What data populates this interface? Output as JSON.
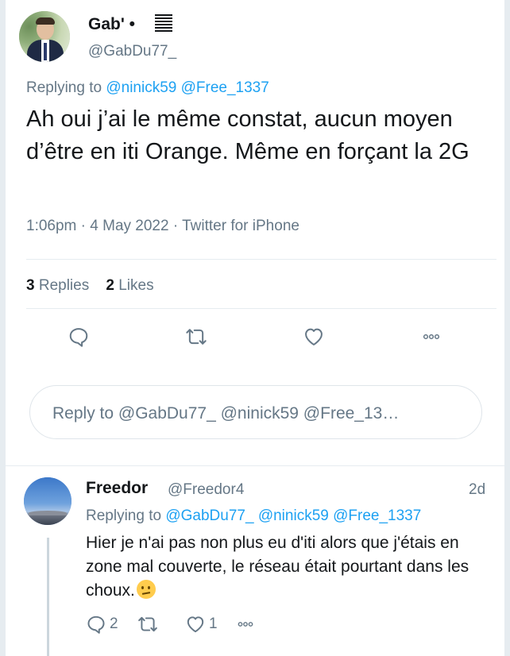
{
  "main_tweet": {
    "name": "Gab' •",
    "handle": "@GabDu77_",
    "replying_prefix": "Replying to",
    "replying_mentions": [
      "@ninick59",
      "@Free_1337"
    ],
    "text": "Ah oui j’ai le même constat, aucun moyen d’être en iti Orange. Même en forçant la 2G",
    "time": "1:06pm",
    "date": "4 May 2022",
    "source": "Twitter for iPhone",
    "replies_count": "3",
    "replies_label": "Replies",
    "likes_count": "2",
    "likes_label": "Likes",
    "icons": [
      "reply-icon",
      "retweet-icon",
      "like-icon",
      "more-icon"
    ]
  },
  "reply_box": {
    "placeholder": "Reply to @GabDu77_ @ninick59 @Free_13…"
  },
  "comment": {
    "name": "Freedor",
    "handle": "@Freedor4",
    "time": "2d",
    "replying_prefix": "Replying to",
    "replying_mentions": [
      "@GabDu77_",
      "@ninick59",
      "@Free_1337"
    ],
    "text": "Hier je n'ai pas non plus eu d'iti alors que j'étais en zone mal couverte, le réseau était pourtant dans les choux.",
    "emoji": "thinking-face",
    "reply_count": "2",
    "like_count": "1"
  },
  "colors": {
    "accent": "#1da1f2",
    "secondary_text": "#657786",
    "primary_text": "#14171a",
    "background": "#e6ecf0"
  }
}
